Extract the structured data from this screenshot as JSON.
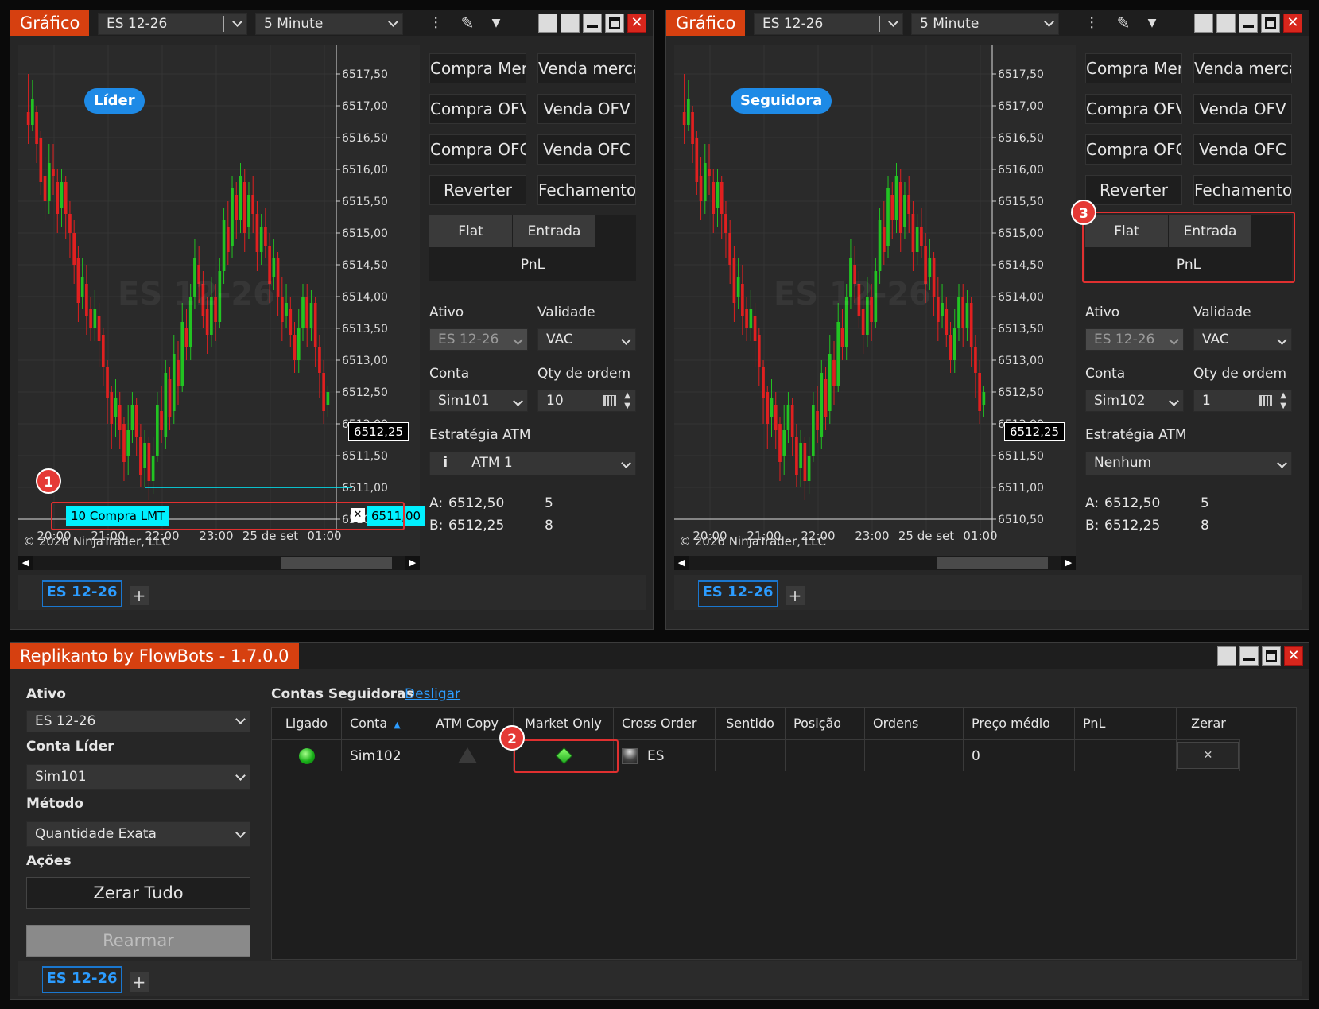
{
  "colors": {
    "accent": "#d64010",
    "up": "#22c322",
    "down": "#e02020",
    "cyan": "#00f0ff",
    "blue": "#1e8ae6"
  },
  "charts": [
    {
      "title": "Gráfico",
      "instrument": "ES 12-26",
      "interval": "5 Minute",
      "tag": "Líder",
      "watermark": "ES 12-26",
      "copyright": "© 2026 NinjaTrader, LLC",
      "price_labels": [
        "6517,50",
        "6517,00",
        "6516,50",
        "6516,00",
        "6515,50",
        "6515,00",
        "6514,50",
        "6514,00",
        "6513,50",
        "6513,00",
        "6512,50",
        "6512,00",
        "6511,50",
        "6511,00",
        "6510,50"
      ],
      "time_labels": [
        "20:00",
        "21:00",
        "22:00",
        "23:00",
        "25 de set",
        "01:00"
      ],
      "last_price": "6512,25",
      "order": {
        "label": "10 Compra LMT",
        "price": "6511,00",
        "close": "✕"
      },
      "buttons": [
        "Compra Mercado",
        "Venda mercado",
        "Compra OFV",
        "Venda OFV",
        "Compra OFC",
        "Venda OFC",
        "Reverter",
        "Fechamento"
      ],
      "seg": {
        "flat": "Flat",
        "entrada": "Entrada",
        "pnl": "PnL"
      },
      "ativo_label": "Ativo",
      "ativo": "ES 12-26",
      "validade_label": "Validade",
      "validade": "VAC",
      "conta_label": "Conta",
      "conta": "Sim101",
      "qty_label": "Qty de ordem",
      "qty": "10",
      "atm_label": "Estratégia ATM",
      "atm": "ATM 1",
      "atm_info": "i",
      "ask_label": "A:",
      "ask": "6512,50",
      "ask_size": "5",
      "bid_label": "B:",
      "bid": "6512,25",
      "bid_size": "8",
      "tab": "ES 12-26",
      "badge": "1"
    },
    {
      "title": "Gráfico",
      "instrument": "ES 12-26",
      "interval": "5 Minute",
      "tag": "Seguidora",
      "watermark": "ES 12-26",
      "copyright": "© 2026 NinjaTrader, LLC",
      "price_labels": [
        "6517,50",
        "6517,00",
        "6516,50",
        "6516,00",
        "6515,50",
        "6515,00",
        "6514,50",
        "6514,00",
        "6513,50",
        "6513,00",
        "6512,50",
        "6512,00",
        "6511,50",
        "6511,00",
        "6510,50"
      ],
      "time_labels": [
        "20:00",
        "21:00",
        "22:00",
        "23:00",
        "25 de set",
        "01:00"
      ],
      "last_price": "6512,25",
      "buttons": [
        "Compra Mercado",
        "Venda mercado",
        "Compra OFV",
        "Venda OFV",
        "Compra OFC",
        "Venda OFC",
        "Reverter",
        "Fechamento"
      ],
      "seg": {
        "flat": "Flat",
        "entrada": "Entrada",
        "pnl": "PnL"
      },
      "ativo_label": "Ativo",
      "ativo": "ES 12-26",
      "validade_label": "Validade",
      "validade": "VAC",
      "conta_label": "Conta",
      "conta": "Sim102",
      "qty_label": "Qty de ordem",
      "qty": "1",
      "atm_label": "Estratégia ATM",
      "atm": "Nenhum",
      "ask_label": "A:",
      "ask": "6512,50",
      "ask_size": "5",
      "bid_label": "B:",
      "bid": "6512,25",
      "bid_size": "8",
      "tab": "ES 12-26",
      "badge": "3"
    }
  ],
  "candles": [
    [
      6516.9,
      6516.7,
      6517.5,
      6516.4
    ],
    [
      6516.7,
      6517.1,
      6517.4,
      6516.6
    ],
    [
      6516.9,
      6516.4,
      6517.0,
      6516.1
    ],
    [
      6516.5,
      6515.8,
      6516.6,
      6515.6
    ],
    [
      6515.9,
      6515.5,
      6516.2,
      6515.2
    ],
    [
      6515.5,
      6516.1,
      6516.4,
      6515.3
    ],
    [
      6516.0,
      6515.9,
      6516.4,
      6515.6
    ],
    [
      6515.8,
      6515.3,
      6516.0,
      6515.0
    ],
    [
      6515.4,
      6515.8,
      6516.0,
      6515.1
    ],
    [
      6515.8,
      6515.3,
      6515.9,
      6514.9
    ],
    [
      6515.3,
      6515.0,
      6515.5,
      6514.6
    ],
    [
      6515.0,
      6514.5,
      6515.2,
      6514.2
    ],
    [
      6514.6,
      6513.9,
      6514.8,
      6513.6
    ],
    [
      6514.0,
      6514.3,
      6514.6,
      6513.8
    ],
    [
      6514.2,
      6513.7,
      6514.5,
      6513.4
    ],
    [
      6513.8,
      6513.5,
      6514.0,
      6513.3
    ],
    [
      6513.5,
      6513.8,
      6514.1,
      6513.3
    ],
    [
      6513.7,
      6513.3,
      6513.9,
      6512.9
    ],
    [
      6513.4,
      6512.9,
      6513.5,
      6512.6
    ],
    [
      6512.9,
      6512.4,
      6513.0,
      6512.0
    ],
    [
      6512.5,
      6512.0,
      6512.6,
      6511.6
    ],
    [
      6512.1,
      6512.4,
      6512.7,
      6511.8
    ],
    [
      6512.3,
      6511.9,
      6512.5,
      6511.6
    ],
    [
      6512.0,
      6511.4,
      6512.1,
      6511.1
    ],
    [
      6511.5,
      6511.9,
      6512.3,
      6511.2
    ],
    [
      6511.9,
      6512.3,
      6512.5,
      6511.7
    ],
    [
      6512.3,
      6511.8,
      6512.4,
      6511.5
    ],
    [
      6511.8,
      6511.2,
      6512.0,
      6511.0
    ],
    [
      6511.3,
      6511.7,
      6511.9,
      6511.0
    ],
    [
      6511.7,
      6511.1,
      6511.8,
      6510.8
    ],
    [
      6511.1,
      6511.5,
      6511.8,
      6510.9
    ],
    [
      6511.5,
      6512.3,
      6512.5,
      6511.4
    ],
    [
      6512.2,
      6511.9,
      6512.6,
      6511.7
    ],
    [
      6511.8,
      6512.8,
      6513.0,
      6511.6
    ],
    [
      6512.7,
      6512.1,
      6512.9,
      6511.9
    ],
    [
      6512.2,
      6513.1,
      6513.4,
      6512.0
    ],
    [
      6513.0,
      6512.6,
      6513.3,
      6512.3
    ],
    [
      6512.6,
      6513.6,
      6513.9,
      6512.5
    ],
    [
      6513.5,
      6513.2,
      6513.8,
      6513.0
    ],
    [
      6513.2,
      6514.0,
      6514.2,
      6513.0
    ],
    [
      6514.0,
      6514.6,
      6514.9,
      6513.8
    ],
    [
      6514.5,
      6514.2,
      6514.8,
      6513.9
    ],
    [
      6514.2,
      6513.7,
      6514.4,
      6513.5
    ],
    [
      6513.8,
      6513.4,
      6514.0,
      6513.1
    ],
    [
      6513.4,
      6514.0,
      6514.3,
      6513.2
    ],
    [
      6514.0,
      6513.6,
      6514.2,
      6513.3
    ],
    [
      6513.6,
      6514.4,
      6514.6,
      6513.5
    ],
    [
      6514.4,
      6515.2,
      6515.4,
      6514.2
    ],
    [
      6515.1,
      6514.7,
      6515.5,
      6514.5
    ],
    [
      6514.8,
      6515.7,
      6515.9,
      6514.6
    ],
    [
      6515.6,
      6515.2,
      6515.8,
      6514.9
    ],
    [
      6515.2,
      6515.9,
      6516.1,
      6515.0
    ],
    [
      6515.8,
      6515.0,
      6516.0,
      6514.7
    ],
    [
      6515.1,
      6515.6,
      6515.8,
      6514.9
    ],
    [
      6515.6,
      6515.3,
      6515.9,
      6515.0
    ],
    [
      6515.3,
      6514.7,
      6515.5,
      6514.4
    ],
    [
      6514.7,
      6515.1,
      6515.3,
      6514.5
    ],
    [
      6515.1,
      6514.8,
      6515.4,
      6514.6
    ],
    [
      6514.8,
      6514.2,
      6515.0,
      6513.9
    ],
    [
      6514.3,
      6514.6,
      6514.9,
      6514.1
    ],
    [
      6514.6,
      6514.0,
      6514.7,
      6513.7
    ],
    [
      6514.0,
      6513.6,
      6514.3,
      6513.3
    ],
    [
      6513.7,
      6513.9,
      6514.2,
      6513.5
    ],
    [
      6513.8,
      6513.4,
      6514.0,
      6513.2
    ],
    [
      6513.4,
      6513.0,
      6513.6,
      6512.8
    ],
    [
      6513.0,
      6513.5,
      6513.8,
      6512.8
    ],
    [
      6513.5,
      6514.0,
      6514.2,
      6513.3
    ],
    [
      6514.0,
      6513.5,
      6514.2,
      6513.2
    ],
    [
      6513.5,
      6513.9,
      6514.1,
      6513.3
    ],
    [
      6513.9,
      6513.2,
      6514.0,
      6512.9
    ],
    [
      6513.2,
      6512.8,
      6513.4,
      6512.4
    ],
    [
      6512.8,
      6512.2,
      6513.0,
      6512.0
    ],
    [
      6512.3,
      6512.5,
      6512.6,
      6512.1
    ]
  ],
  "replikanto": {
    "title": "Replikanto by FlowBots - 1.7.0.0",
    "ativo_label": "Ativo",
    "ativo": "ES 12-26",
    "conta_lider_label": "Conta Líder",
    "conta_lider": "Sim101",
    "metodo_label": "Método",
    "metodo": "Quantidade Exata",
    "acoes_label": "Ações",
    "zerar_tudo": "Zerar Tudo",
    "rearmar": "Rearmar",
    "contas_label": "Contas Seguidoras",
    "desligar": "Desligar",
    "columns": [
      "Ligado",
      "Conta",
      "ATM Copy",
      "Market Only",
      "Cross Order",
      "Sentido",
      "Posição",
      "Ordens",
      "Preço médio",
      "PnL",
      "Zerar"
    ],
    "row": {
      "conta": "Sim102",
      "cross": "ES",
      "preco_medio": "0",
      "zerar": "✕"
    },
    "tab": "ES 12-26",
    "badge": "2"
  },
  "ui": {
    "plus": "+",
    "left": "◀",
    "right": "▶",
    "thumb": "||"
  }
}
